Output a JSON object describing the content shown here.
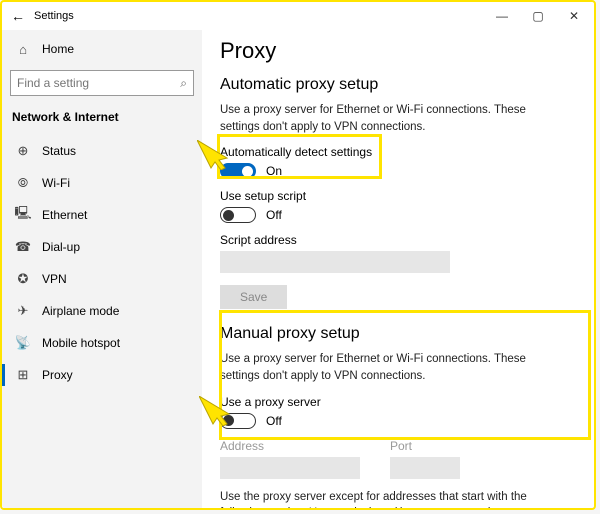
{
  "window": {
    "title": "Settings",
    "minimize": "—",
    "maximize": "▢",
    "close": "✕"
  },
  "sidebar": {
    "home": "Home",
    "search_placeholder": "Find a setting",
    "category": "Network & Internet",
    "items": [
      {
        "label": "Status",
        "icon": "⊕"
      },
      {
        "label": "Wi-Fi",
        "icon": "⦾"
      },
      {
        "label": "Ethernet",
        "icon": "🖳"
      },
      {
        "label": "Dial-up",
        "icon": "☎"
      },
      {
        "label": "VPN",
        "icon": "✪"
      },
      {
        "label": "Airplane mode",
        "icon": "✈"
      },
      {
        "label": "Mobile hotspot",
        "icon": "📡"
      },
      {
        "label": "Proxy",
        "icon": "⊞"
      }
    ]
  },
  "page": {
    "title": "Proxy",
    "auto": {
      "heading": "Automatic proxy setup",
      "desc": "Use a proxy server for Ethernet or Wi-Fi connections. These settings don't apply to VPN connections.",
      "detect_label": "Automatically detect settings",
      "detect_state": "On",
      "script_label": "Use setup script",
      "script_state": "Off",
      "script_addr_label": "Script address",
      "save": "Save"
    },
    "manual": {
      "heading": "Manual proxy setup",
      "desc": "Use a proxy server for Ethernet or Wi-Fi connections. These settings don't apply to VPN connections.",
      "use_label": "Use a proxy server",
      "use_state": "Off",
      "addr_label": "Address",
      "port_label": "Port",
      "exceptions_desc": "Use the proxy server except for addresses that start with the following entries. Use semicolons (;) to separate entries."
    }
  }
}
